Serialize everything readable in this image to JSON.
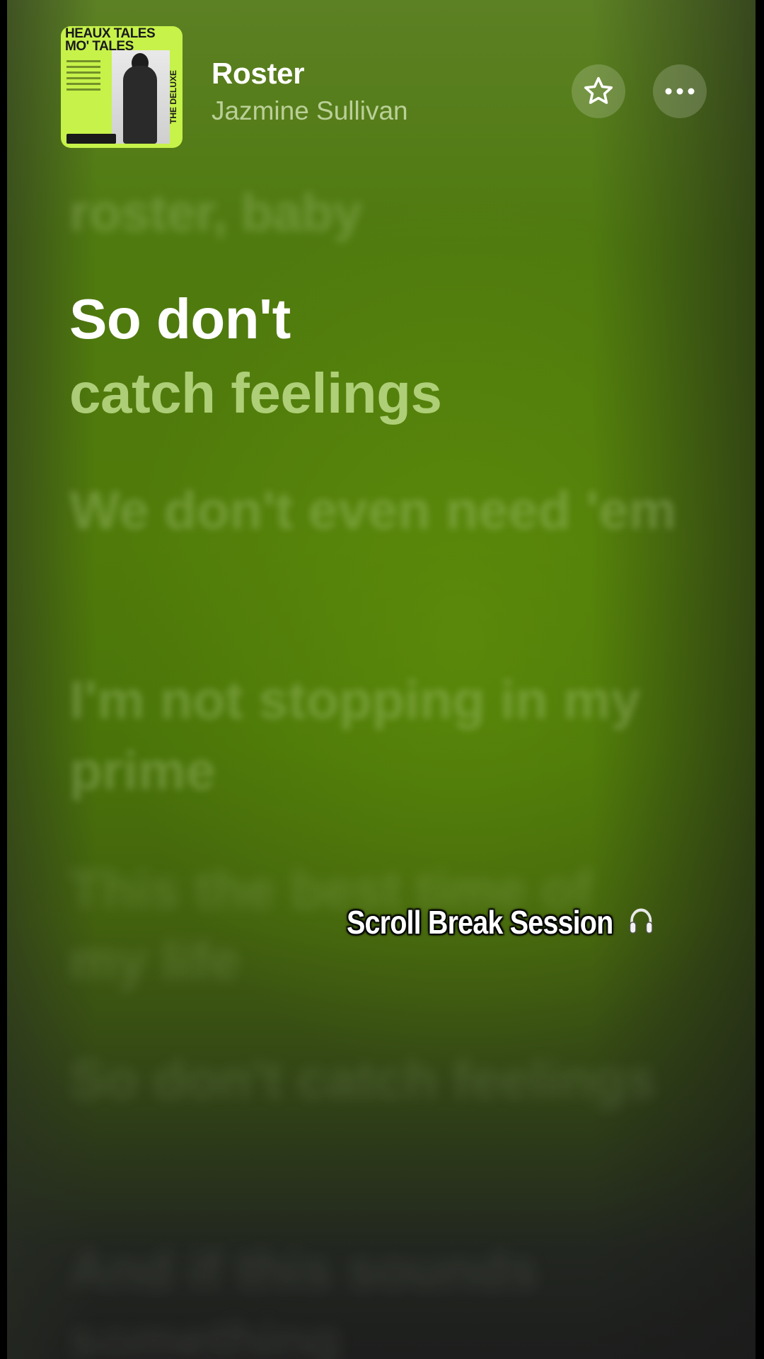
{
  "album": {
    "art_title": "HEAUX TALES MO' TALES",
    "art_side_text": "THE DELUXE",
    "icon": "album-art"
  },
  "track": {
    "title": "Roster",
    "artist": "Jazmine Sullivan"
  },
  "actions": {
    "favorite_icon": "star-icon",
    "more_icon": "ellipsis-icon"
  },
  "lyrics": {
    "previous": "roster, baby",
    "active_line_1": "So don't",
    "active_line_2": "catch feelings",
    "upcoming": [
      "We don't even need 'em",
      "I'm not stopping in my prime",
      "This the best time of my life",
      "So don't catch feelings",
      "And if this sounds something"
    ]
  },
  "overlay": {
    "caption": "Scroll Break Session",
    "icon": "headphones-icon"
  },
  "colors": {
    "background_green": "#507b0a",
    "background_dark": "#1d1e1d",
    "album_lime": "#c6f24a"
  }
}
